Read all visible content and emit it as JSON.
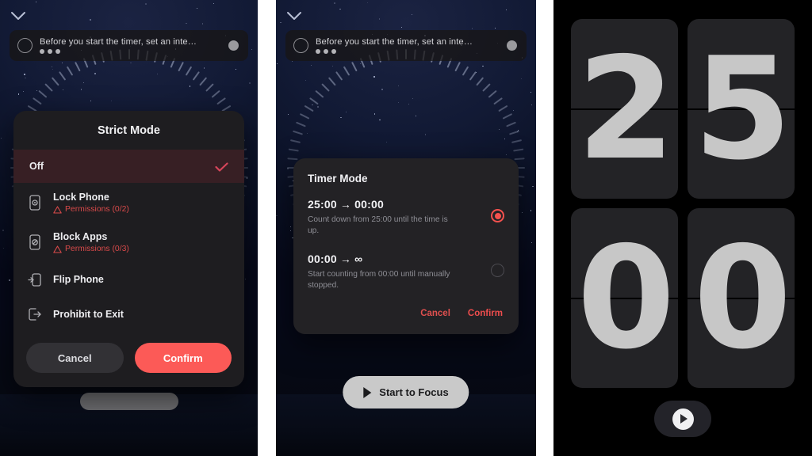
{
  "panels": [
    {
      "id": "strict-mode",
      "banner": {
        "text": "Before you start the timer, set an inte…",
        "ring_icon": "circle-outline-icon",
        "dots_icon": "three-dots-icon",
        "right_dot_icon": "grey-dot-icon"
      },
      "chevron_icon": "chevron-down-icon",
      "dialog": {
        "title": "Strict Mode",
        "selected_row": {
          "label": "Off",
          "check_icon": "check-icon",
          "check_color": "#d6455a",
          "bg_color": "#5a242a"
        },
        "options": [
          {
            "label": "Lock Phone",
            "permission": "Permissions (0/2)",
            "icon": "phone-lock-icon",
            "warn_icon": "warning-triangle-icon"
          },
          {
            "label": "Block Apps",
            "permission": "Permissions (0/3)",
            "icon": "app-block-icon",
            "warn_icon": "warning-triangle-icon"
          },
          {
            "label": "Flip Phone",
            "permission": "",
            "icon": "flip-phone-icon",
            "warn_icon": ""
          },
          {
            "label": "Prohibit to Exit",
            "permission": "",
            "icon": "exit-arrow-icon",
            "warn_icon": ""
          }
        ],
        "cancel_label": "Cancel",
        "confirm_label": "Confirm",
        "confirm_color": "#fc5a57"
      }
    },
    {
      "id": "timer-mode",
      "banner": {
        "text": "Before you start the timer, set an inte…",
        "ring_icon": "circle-outline-icon",
        "dots_icon": "three-dots-icon",
        "right_dot_icon": "grey-dot-icon"
      },
      "chevron_icon": "chevron-down-icon",
      "dialog": {
        "title": "Timer Mode",
        "options": [
          {
            "heading": "25:00 → 00:00",
            "description": "Count down from 25:00 until the time is up.",
            "selected": true
          },
          {
            "heading": "00:00 → ∞",
            "description": "Start counting from 00:00 until manually stopped.",
            "selected": false
          }
        ],
        "cancel_label": "Cancel",
        "confirm_label": "Confirm",
        "accent_color": "#ef4d4d"
      },
      "focus_button": {
        "label": "Start to Focus",
        "icon": "play-triangle-icon"
      }
    },
    {
      "id": "flip-clock",
      "digits": [
        "2",
        "5",
        "0",
        "0"
      ],
      "display_time": "25:00",
      "play_button": {
        "icon": "play-circle-icon"
      }
    }
  ]
}
